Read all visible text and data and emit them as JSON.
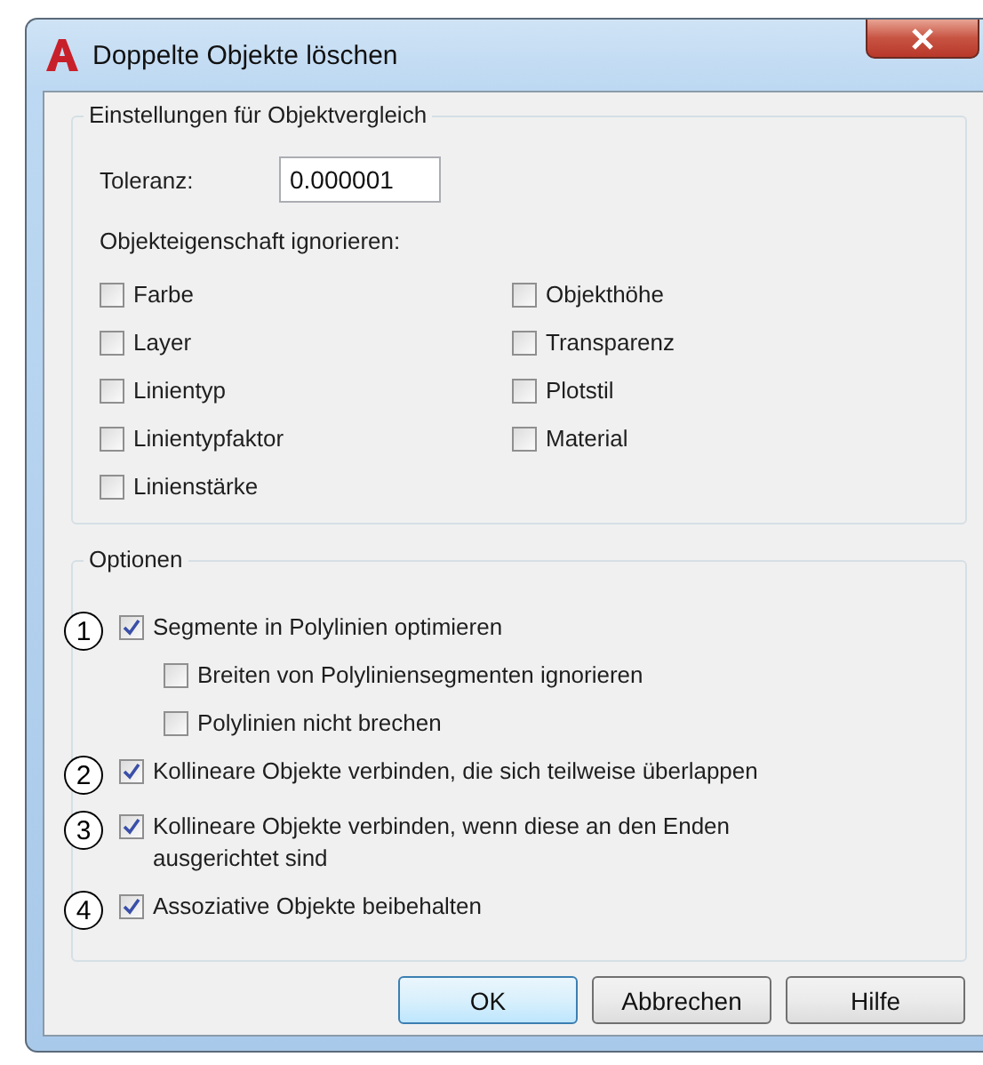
{
  "window": {
    "title": "Doppelte Objekte löschen"
  },
  "comparison": {
    "title": "Einstellungen für Objektvergleich",
    "tolerance": {
      "label": "Toleranz:",
      "value": "0.000001"
    },
    "ignore_label": "Objekteigenschaft ignorieren:",
    "columns": [
      {
        "items": [
          {
            "label": "Farbe",
            "checked": false
          },
          {
            "label": "Layer",
            "checked": false
          },
          {
            "label": "Linientyp",
            "checked": false
          },
          {
            "label": "Linientypfaktor",
            "checked": false
          },
          {
            "label": "Linienstärke",
            "checked": false
          }
        ]
      },
      {
        "items": [
          {
            "label": "Objekthöhe",
            "checked": false
          },
          {
            "label": "Transparenz",
            "checked": false
          },
          {
            "label": "Plotstil",
            "checked": false
          },
          {
            "label": "Material",
            "checked": false
          }
        ]
      }
    ]
  },
  "options": {
    "title": "Optionen",
    "items": [
      {
        "callout": "1",
        "label": "Segmente in Polylinien optimieren",
        "checked": true,
        "children": [
          {
            "label": "Breiten von Polyliniensegmenten ignorieren",
            "checked": false
          },
          {
            "label": "Polylinien nicht brechen",
            "checked": false
          }
        ]
      },
      {
        "callout": "2",
        "label": "Kollineare Objekte verbinden, die sich teilweise überlappen",
        "checked": true
      },
      {
        "callout": "3",
        "label": "Kollineare Objekte verbinden, wenn diese an den Enden ausgerichtet sind",
        "checked": true
      },
      {
        "callout": "4",
        "label": "Assoziative Objekte beibehalten",
        "checked": true
      }
    ]
  },
  "buttons": [
    {
      "label": "OK",
      "default": true
    },
    {
      "label": "Abbrechen",
      "default": false
    },
    {
      "label": "Hilfe",
      "default": false
    }
  ]
}
